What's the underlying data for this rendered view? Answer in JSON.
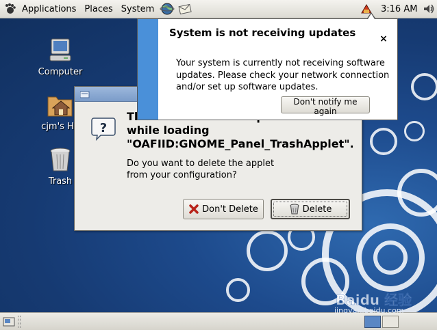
{
  "top_panel": {
    "menus": [
      "Applications",
      "Places",
      "System"
    ],
    "clock": "3:16 AM"
  },
  "desktop_icons": [
    {
      "label": "Computer",
      "icon": "computer-icon"
    },
    {
      "label": "cjm's Ho",
      "icon": "home-folder-icon"
    },
    {
      "label": "Trash",
      "icon": "trash-icon"
    }
  ],
  "dialog": {
    "heading": "Th                              p\nwhile loading\n\"OAFIID:GNOME_Panel_TrashApplet\".",
    "message": "Do you want to delete the applet from your configuration?",
    "dont_delete_label": "Don't Delete",
    "delete_label": "Delete"
  },
  "notification": {
    "title": "System is not receiving updates",
    "body": "Your system is currently not receiving software updates.  Please check your network connection and/or set up software updates.",
    "button_label": "Don't notify me again",
    "close_glyph": "×"
  },
  "watermark": {
    "text": "Baidu 经验",
    "url": "jingyan.baidu.com"
  },
  "colors": {
    "desktop_blue": "#1d4a8c",
    "bubble_accent": "#4a90d9",
    "titlebar_blue": "#7b9cc9"
  }
}
